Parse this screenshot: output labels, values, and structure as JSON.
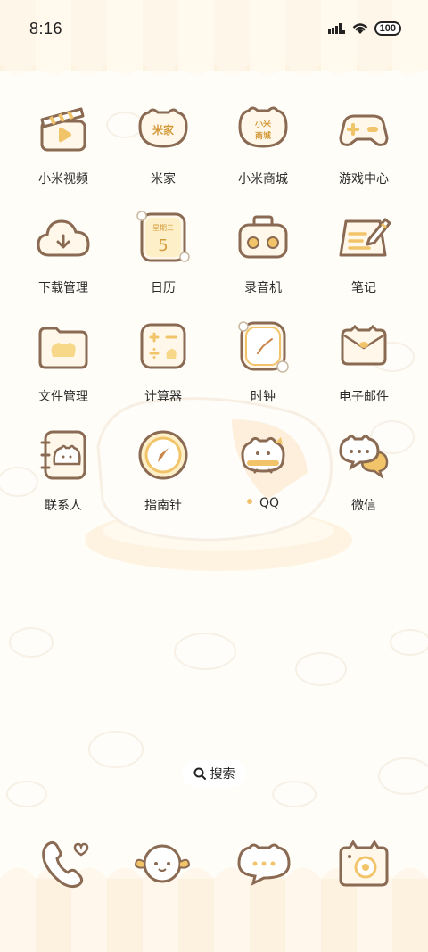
{
  "status_bar": {
    "time": "8:16",
    "battery": "100"
  },
  "apps": [
    {
      "label": "小米视频",
      "icon": "clapperboard-icon"
    },
    {
      "label": "米家",
      "icon": "mijia-icon",
      "icon_text": "米家"
    },
    {
      "label": "小米商城",
      "icon": "mall-icon",
      "icon_text_1": "小米",
      "icon_text_2": "商城"
    },
    {
      "label": "游戏中心",
      "icon": "gamepad-icon"
    },
    {
      "label": "下载管理",
      "icon": "cloud-download-icon"
    },
    {
      "label": "日历",
      "icon": "calendar-icon",
      "icon_text_1": "星期三",
      "icon_text_2": "5"
    },
    {
      "label": "录音机",
      "icon": "recorder-icon"
    },
    {
      "label": "笔记",
      "icon": "notes-icon"
    },
    {
      "label": "文件管理",
      "icon": "folder-icon"
    },
    {
      "label": "计算器",
      "icon": "calculator-icon"
    },
    {
      "label": "时钟",
      "icon": "clock-icon"
    },
    {
      "label": "电子邮件",
      "icon": "mail-icon"
    },
    {
      "label": "联系人",
      "icon": "contacts-icon"
    },
    {
      "label": "指南针",
      "icon": "compass-icon"
    },
    {
      "label": "QQ",
      "icon": "qq-icon"
    },
    {
      "label": "微信",
      "icon": "wechat-icon"
    }
  ],
  "search": {
    "label": "搜索"
  },
  "dock": [
    {
      "icon": "phone-icon"
    },
    {
      "icon": "smiley-icon"
    },
    {
      "icon": "message-icon"
    },
    {
      "icon": "camera-icon"
    }
  ],
  "colors": {
    "outline": "#8a6a52",
    "accent": "#f2c46a",
    "cream": "#fff8ea"
  }
}
